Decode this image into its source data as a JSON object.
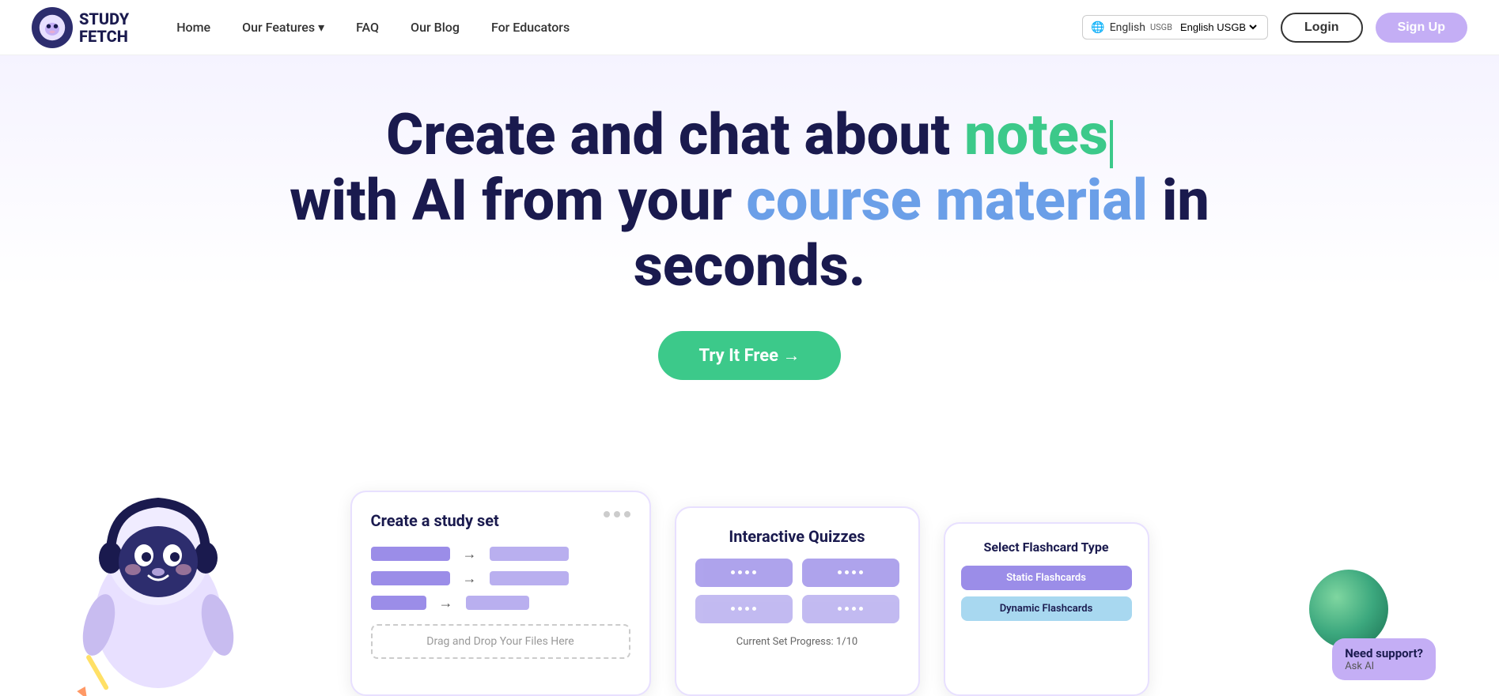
{
  "nav": {
    "logo_line1": "STUDY",
    "logo_line2": "FETCH",
    "links": [
      {
        "label": "Home",
        "id": "home",
        "has_dropdown": false
      },
      {
        "label": "Our Features",
        "id": "features",
        "has_dropdown": true
      },
      {
        "label": "FAQ",
        "id": "faq",
        "has_dropdown": false
      },
      {
        "label": "Our Blog",
        "id": "blog",
        "has_dropdown": false
      },
      {
        "label": "For Educators",
        "id": "educators",
        "has_dropdown": false
      }
    ],
    "lang_label": "English",
    "lang_code": "USGB",
    "login_label": "Login",
    "signup_label": "Sign Up"
  },
  "hero": {
    "title_part1": "Create and chat about ",
    "title_highlight1": "notes",
    "title_part2": "with AI from your ",
    "title_highlight2": "course material",
    "title_part3": " in seconds.",
    "cta_label": "Try It Free →"
  },
  "cards": {
    "study_set": {
      "title": "Create a study set",
      "drop_label": "Drag and Drop Your Files Here",
      "arrow": "→"
    },
    "quiz": {
      "title": "Interactive Quizzes",
      "progress": "Current Set Progress: 1/10"
    },
    "flashcard": {
      "title": "Select Flashcard Type",
      "option1": "Static Flashcards",
      "option2": "Dynamic Flashcards"
    }
  },
  "support": {
    "title": "Need support?",
    "subtitle": "Ask AI"
  },
  "colors": {
    "brand_dark": "#1a1a4e",
    "green_accent": "#3cc98a",
    "blue_accent": "#6b9fe8",
    "purple_light": "#c4aef5",
    "purple_mid": "#9b8de8"
  }
}
